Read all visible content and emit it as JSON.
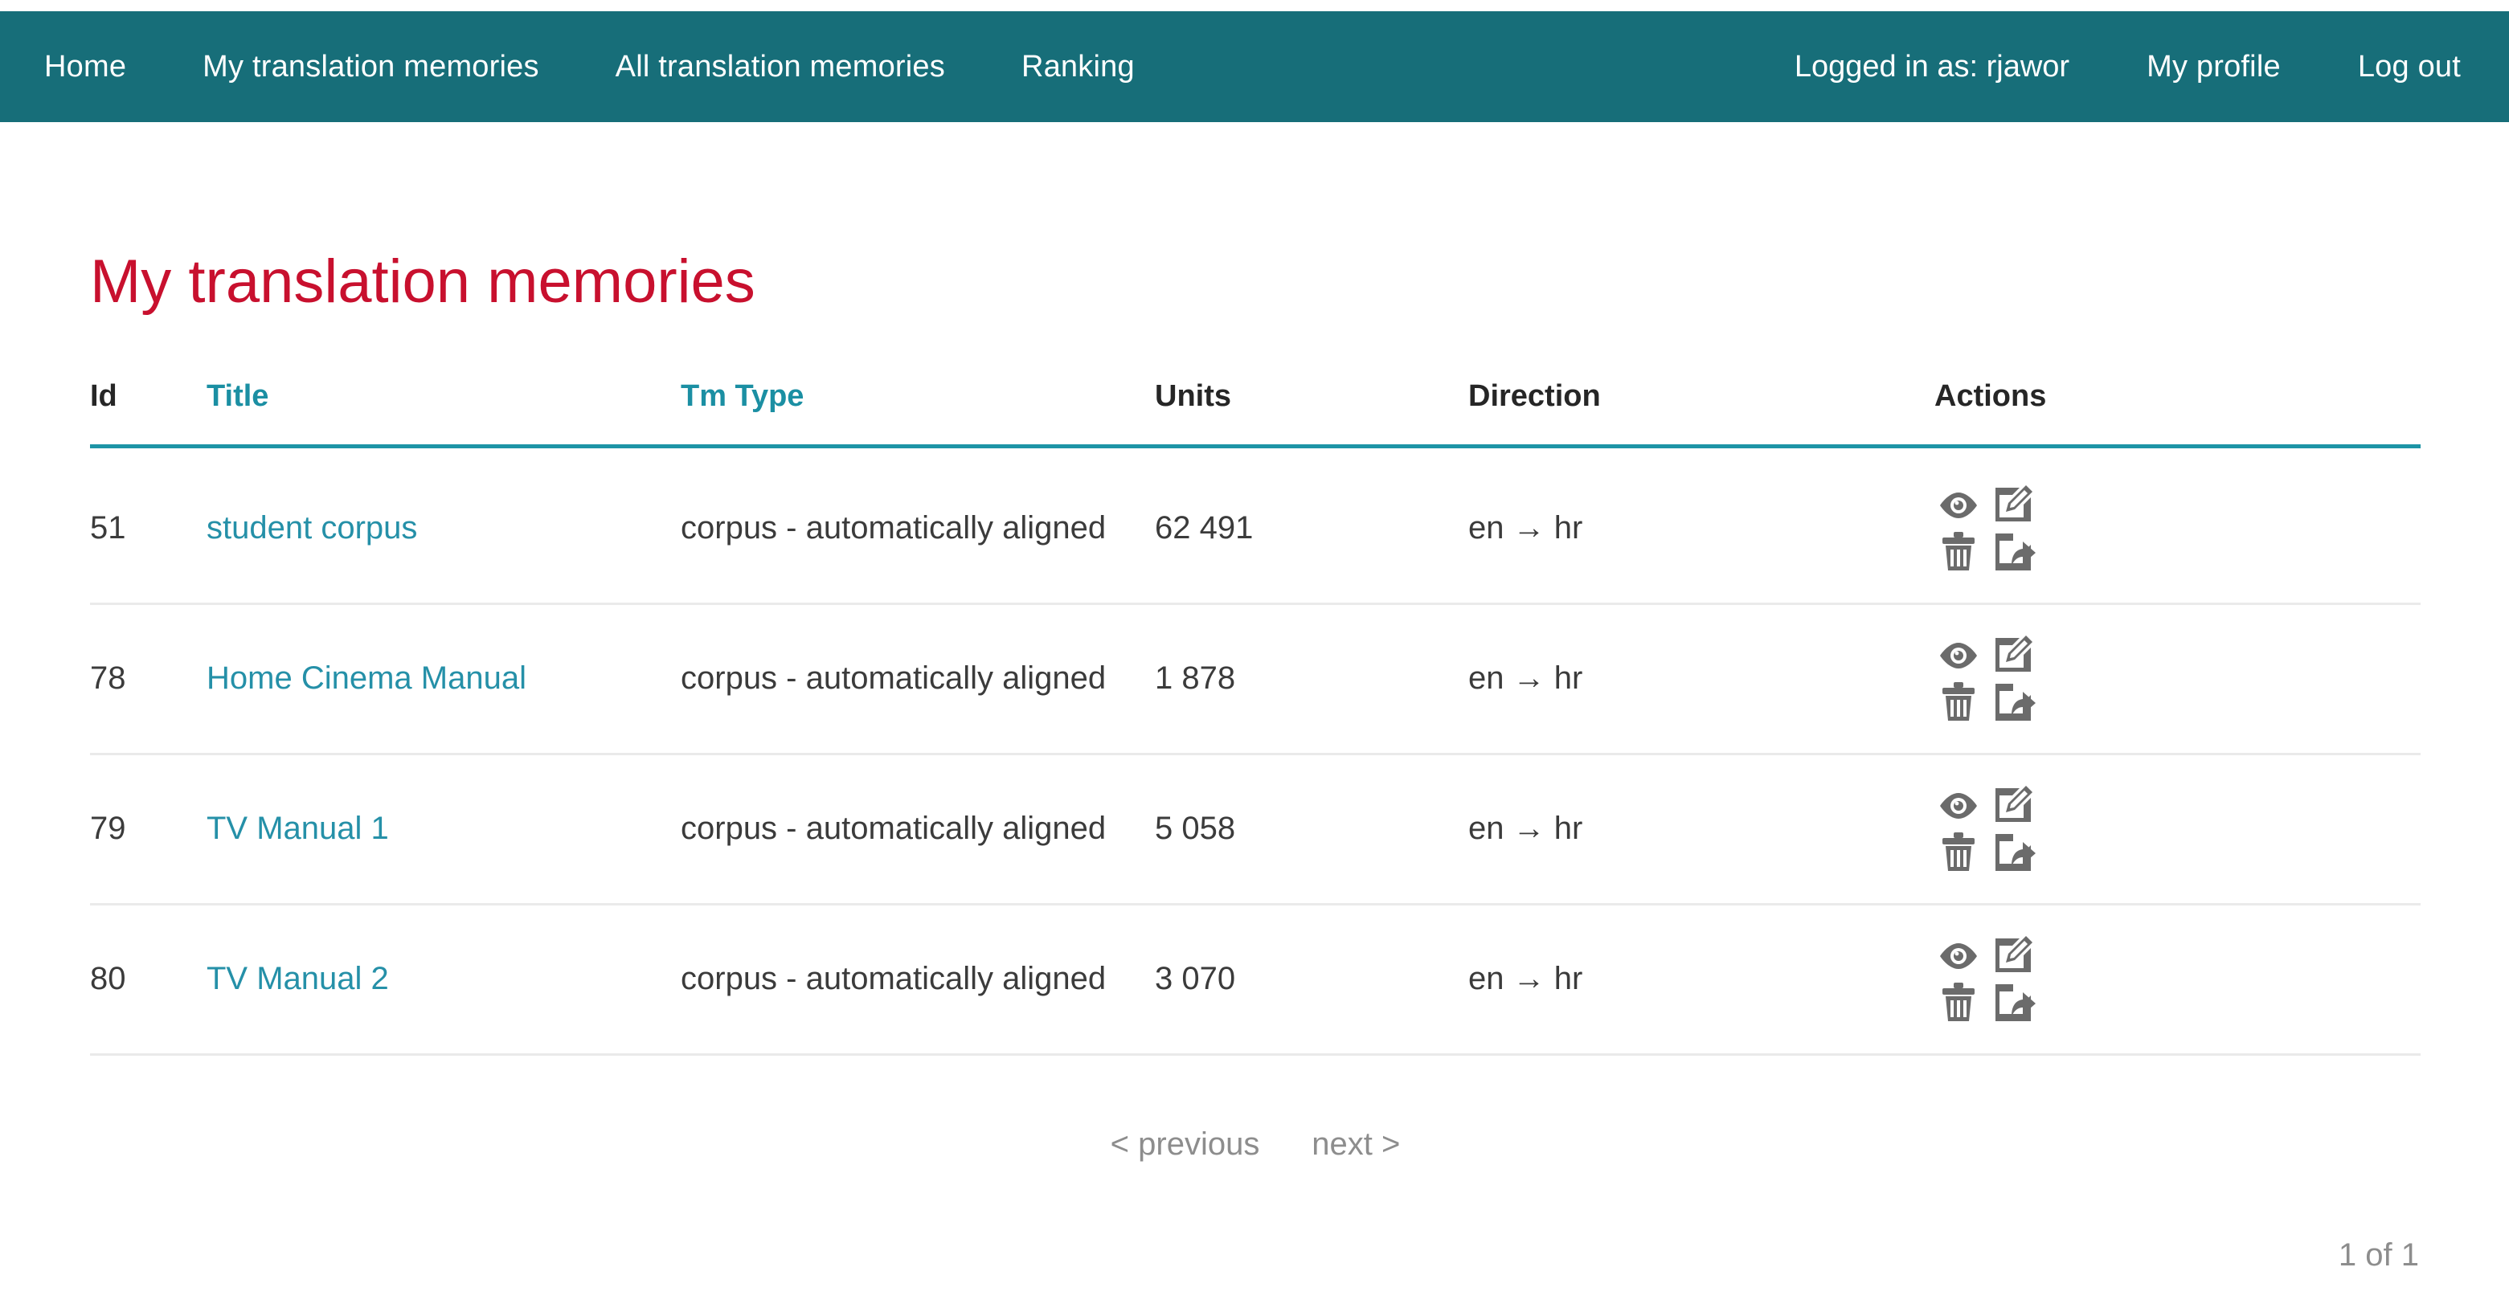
{
  "navbar": {
    "background": "#176e79",
    "left_items": [
      {
        "label": "Home",
        "name": "nav-home"
      },
      {
        "label": "My translation memories",
        "name": "nav-my-translation-memories"
      },
      {
        "label": "All translation memories",
        "name": "nav-all-translation-memories"
      },
      {
        "label": "Ranking",
        "name": "nav-ranking"
      }
    ],
    "logged_in_as": "Logged in as: rjawor",
    "right_items": [
      {
        "label": "My profile",
        "name": "nav-my-profile"
      },
      {
        "label": "Log out",
        "name": "nav-log-out"
      }
    ]
  },
  "page": {
    "title": "My translation memories",
    "title_color": "#c8102e"
  },
  "table": {
    "headers": {
      "id": "Id",
      "title": "Title",
      "tm_type": "Tm Type",
      "units": "Units",
      "direction": "Direction",
      "actions": "Actions"
    },
    "header_link_color": "#1b8fa3",
    "header_rule_color": "#1d94a6",
    "link_color": "#2590a8",
    "rows": [
      {
        "id": "51",
        "title": "student corpus",
        "tm_type": "corpus - automatically aligned",
        "units": "62 491",
        "direction": "en → hr"
      },
      {
        "id": "78",
        "title": "Home Cinema Manual",
        "tm_type": "corpus - automatically aligned",
        "units": "1 878",
        "direction": "en → hr"
      },
      {
        "id": "79",
        "title": "TV Manual 1",
        "tm_type": "corpus - automatically aligned",
        "units": "5 058",
        "direction": "en → hr"
      },
      {
        "id": "80",
        "title": "TV Manual 2",
        "tm_type": "corpus - automatically aligned",
        "units": "3 070",
        "direction": "en → hr"
      }
    ],
    "action_icons": [
      {
        "name": "view-icon",
        "label": "view"
      },
      {
        "name": "edit-icon",
        "label": "edit"
      },
      {
        "name": "delete-icon",
        "label": "delete"
      },
      {
        "name": "export-icon",
        "label": "export"
      }
    ],
    "action_icon_color": "#6b6b6b"
  },
  "pagination": {
    "previous": "< previous",
    "next": "next >",
    "page_count": "1 of 1",
    "text_color": "#8d8d8d"
  }
}
